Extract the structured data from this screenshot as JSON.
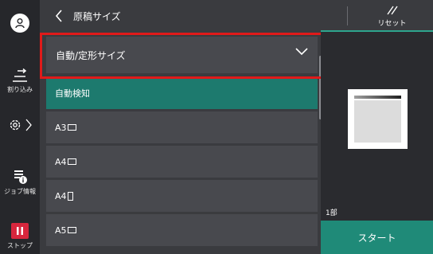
{
  "header": {
    "title": "原稿サイズ",
    "reset_label": "リセット"
  },
  "sidebar": {
    "interrupt_label": "割り込み",
    "job_status_label": "ジョブ情報",
    "stop_label": "ストップ"
  },
  "dropdown": {
    "selected": "自動/定形サイズ"
  },
  "options": [
    {
      "label": "自動検知",
      "selected": true,
      "orientation": ""
    },
    {
      "label": "A3",
      "selected": false,
      "orientation": "landscape"
    },
    {
      "label": "A4",
      "selected": false,
      "orientation": "landscape"
    },
    {
      "label": "A4",
      "selected": false,
      "orientation": "portrait"
    },
    {
      "label": "A5",
      "selected": false,
      "orientation": "landscape"
    }
  ],
  "right_panel": {
    "copies": "1部",
    "start_label": "スタート"
  },
  "colors": {
    "accent": "#1f8a78",
    "highlight_frame": "#e01a1a",
    "stop": "#d7263d"
  }
}
